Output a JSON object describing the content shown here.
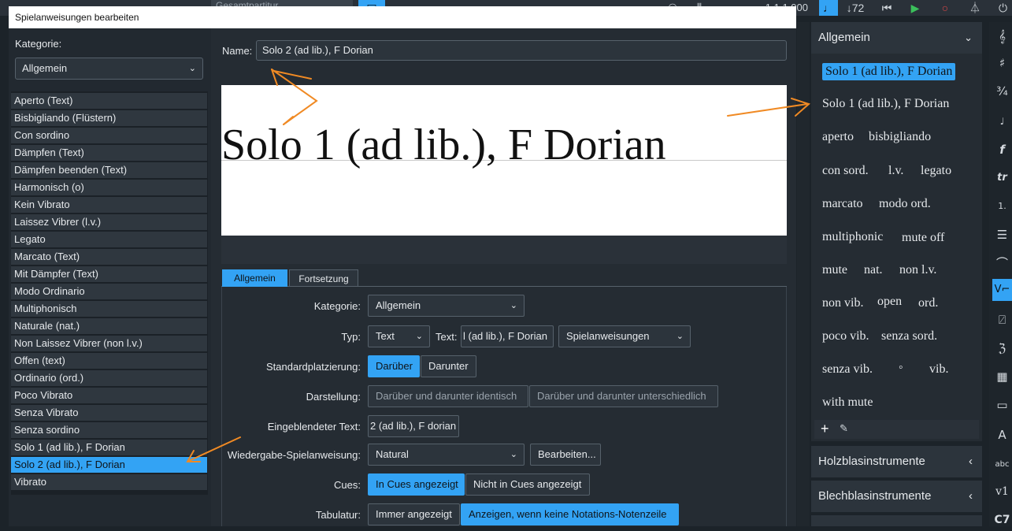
{
  "app_toolbar": {
    "field": "Gesamtpartitur",
    "counter": "1.1.1.000",
    "tempo": "72"
  },
  "dialog": {
    "title": "Spielanweisungen bearbeiten",
    "left": {
      "category_label": "Kategorie:",
      "category_value": "Allgemein",
      "items": [
        "Aperto (Text)",
        "Bisbigliando (Flüstern)",
        "Con sordino",
        "Dämpfen (Text)",
        "Dämpfen beenden (Text)",
        "Harmonisch (o)",
        "Kein Vibrato",
        "Laissez Vibrer (l.v.)",
        "Legato",
        "Marcato (Text)",
        "Mit Dämpfer (Text)",
        "Modo Ordinario",
        "Multiphonisch",
        "Naturale (nat.)",
        "Non Laissez Vibrer (non l.v.)",
        "Offen (text)",
        "Ordinario (ord.)",
        "Poco Vibrato",
        "Senza Vibrato",
        "Senza sordino",
        "Solo 1 (ad lib.), F Dorian",
        "Solo 2 (ad lib.), F Dorian",
        "Vibrato"
      ],
      "selected_index": 21
    },
    "name_label": "Name:",
    "name_value": "Solo 2 (ad lib.), F Dorian",
    "preview_text": "Solo 1 (ad lib.), F Dorian",
    "tabs": [
      "Allgemein",
      "Fortsetzung"
    ],
    "form": {
      "kategorie_label": "Kategorie:",
      "kategorie_value": "Allgemein",
      "typ_label": "Typ:",
      "typ_value": "Text",
      "text_label": "Text:",
      "text_value": "l (ad lib.), F Dorian",
      "style_value": "Spielanweisungen",
      "platz_label": "Standardplatzierung:",
      "platz_options": [
        "Darüber",
        "Darunter"
      ],
      "darst_label": "Darstellung:",
      "darst_options": [
        "Darüber und darunter identisch",
        "Darüber und darunter unterschiedlich"
      ],
      "eingeblendet_label": "Eingeblendeter Text:",
      "eingeblendet_value": "2 (ad lib.), F dorian",
      "wiedergabe_label": "Wiedergabe-Spielanweisung:",
      "wiedergabe_value": "Natural",
      "bearbeiten": "Bearbeiten...",
      "cues_label": "Cues:",
      "cues_options": [
        "In Cues angezeigt",
        "Nicht in Cues angezeigt"
      ],
      "tab_label": "Tabulatur:",
      "tab_options": [
        "Immer angezeigt",
        "Anzeigen, wenn keine Notations-Notenzeile"
      ]
    }
  },
  "panel": {
    "header": "Allgemein",
    "items": [
      "Solo 1 (ad lib.), F Dorian",
      "Solo 1 (ad lib.), F Dorian",
      "aperto",
      "bisbigliando",
      "con sord.",
      "l.v.",
      "legato",
      "marcato",
      "modo ord.",
      "multiphonic",
      "mute off",
      "mute",
      "nat.",
      "non l.v.",
      "non vib.",
      "open",
      "ord.",
      "poco vib.",
      "senza sord.",
      "senza vib.",
      "◦",
      "vib.",
      "with mute"
    ],
    "sections": [
      "Holzblasinstrumente",
      "Blechblasinstrumente"
    ]
  },
  "colors": {
    "accent": "#33a3f4",
    "annotation": "#f08a24"
  }
}
